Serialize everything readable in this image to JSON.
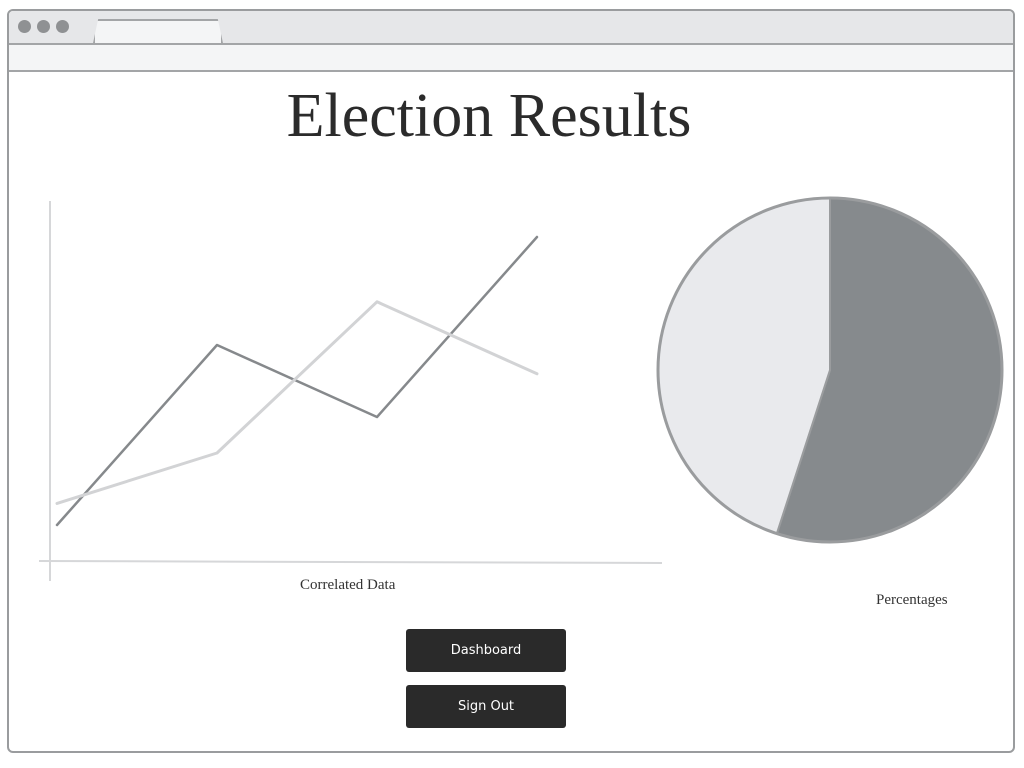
{
  "page": {
    "title": "Election Results"
  },
  "line_chart": {
    "caption": "Correlated Data"
  },
  "pie_chart": {
    "caption": "Percentages"
  },
  "buttons": {
    "dashboard_label": "Dashboard",
    "signout_label": "Sign Out"
  },
  "colors": {
    "series_dark": "#86898c",
    "series_light": "#d2d3d5",
    "pie_dark": "#868a8d",
    "pie_light": "#e9eaed",
    "button_bg": "#2a2a2a"
  },
  "chart_data": [
    {
      "type": "line",
      "x": [
        0,
        1,
        2,
        3
      ],
      "series": [
        {
          "values": [
            5,
            30,
            20,
            45
          ]
        },
        {
          "values": [
            8,
            15,
            36,
            26
          ]
        }
      ],
      "ylim": [
        0,
        50
      ],
      "grid": false
    },
    {
      "type": "pie",
      "slices": [
        {
          "value": 55
        },
        {
          "value": 45
        }
      ]
    }
  ]
}
